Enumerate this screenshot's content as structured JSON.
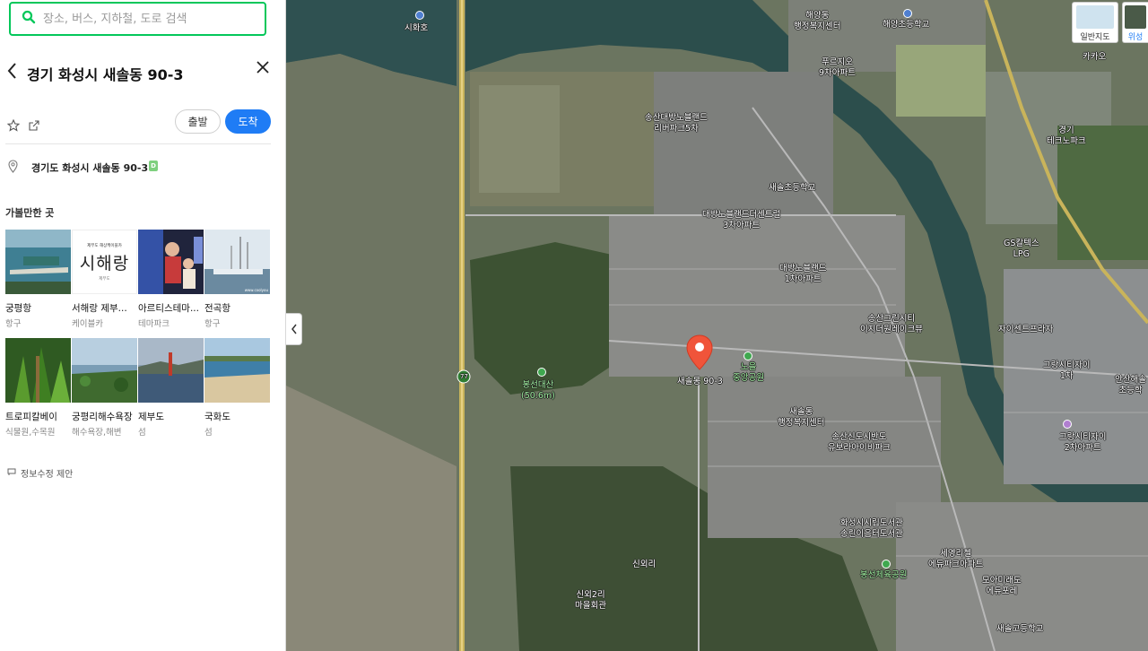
{
  "search": {
    "placeholder": "장소, 버스, 지하철, 도로 검색"
  },
  "place": {
    "title": "경기 화성시 새솔동 90-3",
    "address": "경기도 화성시 새솔동 90-3",
    "depart_label": "출발",
    "arrive_label": "도착"
  },
  "nearby": {
    "title": "가볼만한 곳",
    "items": [
      {
        "name": "궁평항",
        "category": "항구"
      },
      {
        "name": "서해랑 제부...",
        "category": "케이블카",
        "thumb_text": "시해랑",
        "thumb_sub": "제부도 해상케이블카",
        "thumb_tag": "제부도"
      },
      {
        "name": "아르티스테마...",
        "category": "테마파크"
      },
      {
        "name": "전곡항",
        "category": "항구",
        "thumb_credit": "www.coolyou"
      },
      {
        "name": "트로피칼베이",
        "category": "식물원,수목원"
      },
      {
        "name": "궁평리해수욕장",
        "category": "해수욕장,해변"
      },
      {
        "name": "제부도",
        "category": "섬"
      },
      {
        "name": "국화도",
        "category": "섬"
      }
    ]
  },
  "report_label": "정보수정 제안",
  "map": {
    "marker_label": "새솔동 90-3",
    "marker_color": "#f0543a",
    "labels": [
      {
        "text": "시화호"
      },
      {
        "text": "해양동\n행정복지센터"
      },
      {
        "text": "해양초등학교"
      },
      {
        "text": "푸르지오\n9차아파트"
      },
      {
        "text": "카카오"
      },
      {
        "text": "경기\n테크노파크"
      },
      {
        "text": "송산대방노블랜드\n리버파크5차"
      },
      {
        "text": "새솔초등학교"
      },
      {
        "text": "대방노블랜드더센트럴\n3차아파트"
      },
      {
        "text": "대방노블랜드\n1차아파트"
      },
      {
        "text": "GS칼텍스\nLPG"
      },
      {
        "text": "송산그린시티\n이지더원레이크뷰"
      },
      {
        "text": "자이센트프라자"
      },
      {
        "text": "그랑시티자이\n1차"
      },
      {
        "text": "안산해솔\n초등학"
      },
      {
        "text": "봉선대산\n(50.6m)"
      },
      {
        "text": "노을\n중앙공원"
      },
      {
        "text": "새솔동\n행정복지센터"
      },
      {
        "text": "송산신도시반도\n유보라아이비파크"
      },
      {
        "text": "그랑시티자이\n2차아파트"
      },
      {
        "text": "화성시시립도서관\n송린이음터도서관"
      },
      {
        "text": "세영리첼\n에듀파크아파트"
      },
      {
        "text": "봉선체육공원"
      },
      {
        "text": "모아미래도\n에듀포레"
      },
      {
        "text": "신외리"
      },
      {
        "text": "신외2리\n마을회관"
      },
      {
        "text": "새솔고등학교"
      },
      {
        "text": "77"
      }
    ],
    "maptype_normal": "일반지도",
    "maptype_satellite": "위성"
  },
  "colors": {
    "accent_green": "#03c75a",
    "arrive_blue": "#1f7cf5"
  }
}
